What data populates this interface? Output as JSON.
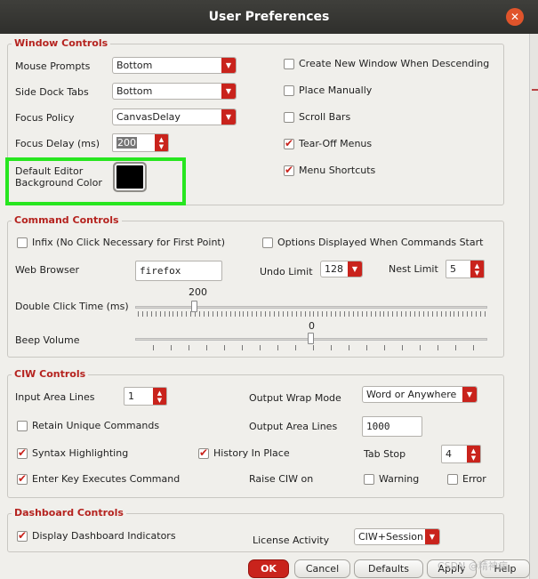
{
  "window": {
    "title": "User Preferences"
  },
  "window_controls": {
    "legend": "Window Controls",
    "mouse_prompts": {
      "label": "Mouse Prompts",
      "value": "Bottom"
    },
    "side_dock_tabs": {
      "label": "Side Dock Tabs",
      "value": "Bottom"
    },
    "focus_policy": {
      "label": "Focus Policy",
      "value": "CanvasDelay"
    },
    "focus_delay": {
      "label": "Focus Delay (ms)",
      "value": "200"
    },
    "default_editor_bg": {
      "label_line1": "Default Editor",
      "label_line2": "Background Color",
      "color": "#000000"
    },
    "create_new_window": {
      "label": "Create New Window When Descending",
      "checked": false
    },
    "place_manually": {
      "label": "Place Manually",
      "checked": false
    },
    "scroll_bars": {
      "label": "Scroll Bars",
      "checked": false
    },
    "tear_off_menus": {
      "label": "Tear-Off Menus",
      "checked": true
    },
    "menu_shortcuts": {
      "label": "Menu Shortcuts",
      "checked": true
    }
  },
  "command_controls": {
    "legend": "Command Controls",
    "infix": {
      "label": "Infix (No Click Necessary for First Point)",
      "checked": false
    },
    "options_displayed": {
      "label": "Options Displayed When Commands Start",
      "checked": false
    },
    "web_browser": {
      "label": "Web Browser",
      "value": "firefox"
    },
    "undo_limit": {
      "label": "Undo Limit",
      "value": "128"
    },
    "nest_limit": {
      "label": "Nest Limit",
      "value": "5"
    },
    "double_click_time": {
      "label": "Double Click Time (ms)",
      "value": "200"
    },
    "beep_volume": {
      "label": "Beep Volume",
      "value": "0"
    }
  },
  "ciw_controls": {
    "legend": "CIW Controls",
    "input_area_lines": {
      "label": "Input Area Lines",
      "value": "1"
    },
    "output_wrap_mode": {
      "label": "Output Wrap Mode",
      "value": "Word or Anywhere"
    },
    "retain_unique": {
      "label": "Retain Unique Commands",
      "checked": false
    },
    "output_area_lines": {
      "label": "Output Area Lines",
      "value": "1000"
    },
    "syntax_highlighting": {
      "label": "Syntax Highlighting",
      "checked": true
    },
    "history_in_place": {
      "label": "History In Place",
      "checked": true
    },
    "tab_stop": {
      "label": "Tab Stop",
      "value": "4"
    },
    "enter_key_executes": {
      "label": "Enter Key Executes Command",
      "checked": true
    },
    "raise_ciw_on": {
      "label": "Raise CIW on"
    },
    "warning": {
      "label": "Warning",
      "checked": false
    },
    "error": {
      "label": "Error",
      "checked": false
    }
  },
  "dashboard_controls": {
    "legend": "Dashboard Controls",
    "display_indicators": {
      "label": "Display Dashboard Indicators",
      "checked": true
    },
    "license_activity": {
      "label": "License Activity",
      "value": "CIW+Session"
    }
  },
  "buttons": {
    "ok": "OK",
    "cancel": "Cancel",
    "defaults": "Defaults",
    "apply": "Apply",
    "help": "Help"
  },
  "watermark": "CSDN @精神病"
}
